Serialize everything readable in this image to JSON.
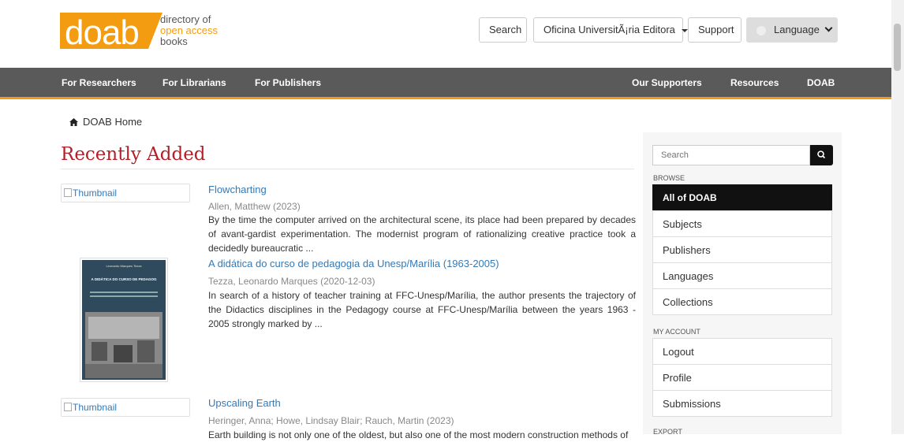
{
  "header": {
    "logo_word": "doab",
    "logo_line1": "directory of",
    "logo_line2": "open access",
    "logo_line3": "books",
    "search_label": "Search",
    "editor_label": "Oficina UniversitÃ¡ria Editora",
    "support_label": "Support",
    "language_label": "Language"
  },
  "nav": {
    "left": [
      "For Researchers",
      "For Librarians",
      "For Publishers"
    ],
    "right": [
      "Our Supporters",
      "Resources",
      "DOAB"
    ]
  },
  "breadcrumb": {
    "home": "DOAB Home"
  },
  "main": {
    "title": "Recently Added",
    "thumbnail_alt": "Thumbnail",
    "items": [
      {
        "title": "Flowcharting",
        "meta": "Allen, Matthew (2023)",
        "abstract": "By the time the computer arrived on the architectural scene, its place had been prepared by decades of avant-gardist experimentation. The modernist program of rationalizing creative practice took a decidedly bureaucratic ..."
      },
      {
        "title": "A didática do curso de pedagogia da Unesp/Marília (1963-2005)",
        "meta": "Tezza, Leonardo Marques (2020-12-03)",
        "abstract": "In search of a history of teacher training at FFC-Unesp/Marília, the author presents the trajectory of the Didactics disciplines in the Pedagogy course at FFC-Unesp/Marília between the years 1963 - 2005 strongly marked by ..."
      },
      {
        "title": "Upscaling Earth",
        "meta": "Heringer, Anna; Howe, Lindsay Blair; Rauch, Martin (2023)",
        "abstract": "Earth building is not only one of the oldest, but also one of the most modern construction methods of"
      }
    ],
    "cover_text": {
      "author": "Leonardo Marques Tezza",
      "title": "A DIDÁTICA DO CURSO DE PEDAGOGIA DA UNESP / MARÍLIA (1963-2005)"
    }
  },
  "sidebar": {
    "search_placeholder": "Search",
    "browse_heading": "BROWSE",
    "browse": [
      "All of DOAB",
      "Subjects",
      "Publishers",
      "Languages",
      "Collections"
    ],
    "account_heading": "MY ACCOUNT",
    "account": [
      "Logout",
      "Profile",
      "Submissions"
    ],
    "export_heading": "EXPORT"
  },
  "colors": {
    "brand_orange": "#f39c12",
    "nav_gray": "#5a5a5a",
    "title_red": "#b3202a",
    "link_blue": "#337ab7"
  }
}
